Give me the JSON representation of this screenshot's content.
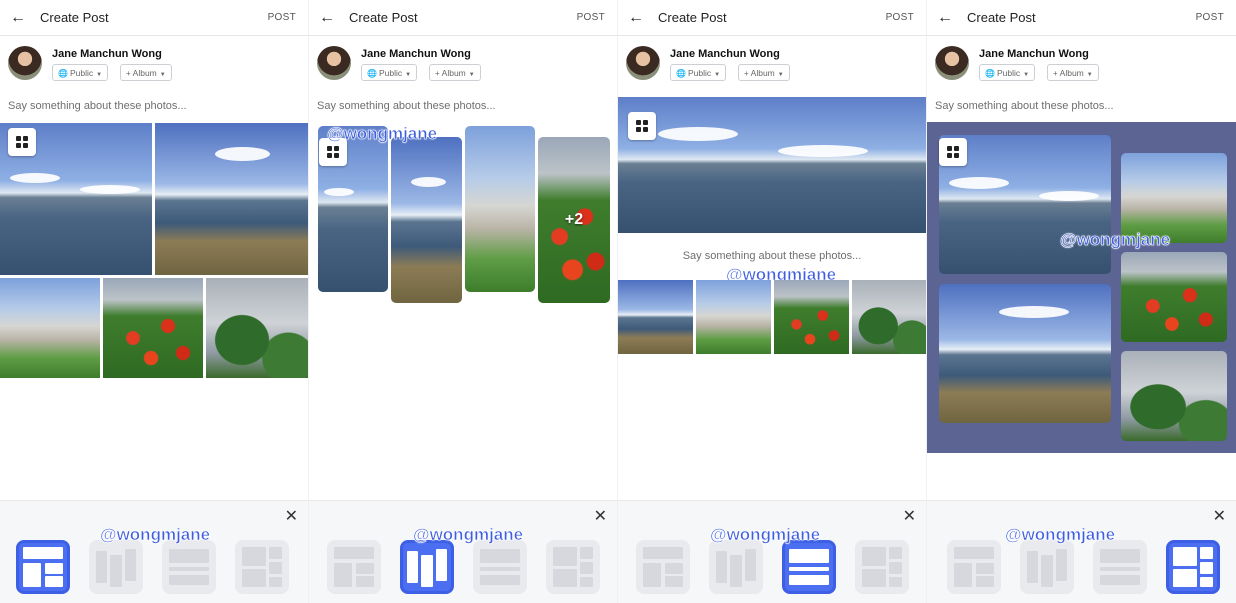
{
  "header": {
    "back_icon": "arrow-left-icon",
    "title": "Create Post",
    "post_label": "POST"
  },
  "user": {
    "name": "Jane Manchun Wong"
  },
  "privacy": {
    "label": "Public",
    "icon": "globe-icon"
  },
  "album": {
    "label": "Album",
    "icon": "plus-icon"
  },
  "caption_placeholder": "Say something about these photos...",
  "overflow_count": "+2",
  "watermark": "@wongmjane",
  "close_icon": "close-icon",
  "layouts": {
    "options": [
      "grid",
      "columns",
      "banner",
      "mosaic"
    ],
    "selected_per_panel": [
      "grid",
      "columns",
      "banner",
      "mosaic"
    ]
  },
  "colors": {
    "accent": "#4c6ef0",
    "mosaic_background": "#5c6494"
  }
}
